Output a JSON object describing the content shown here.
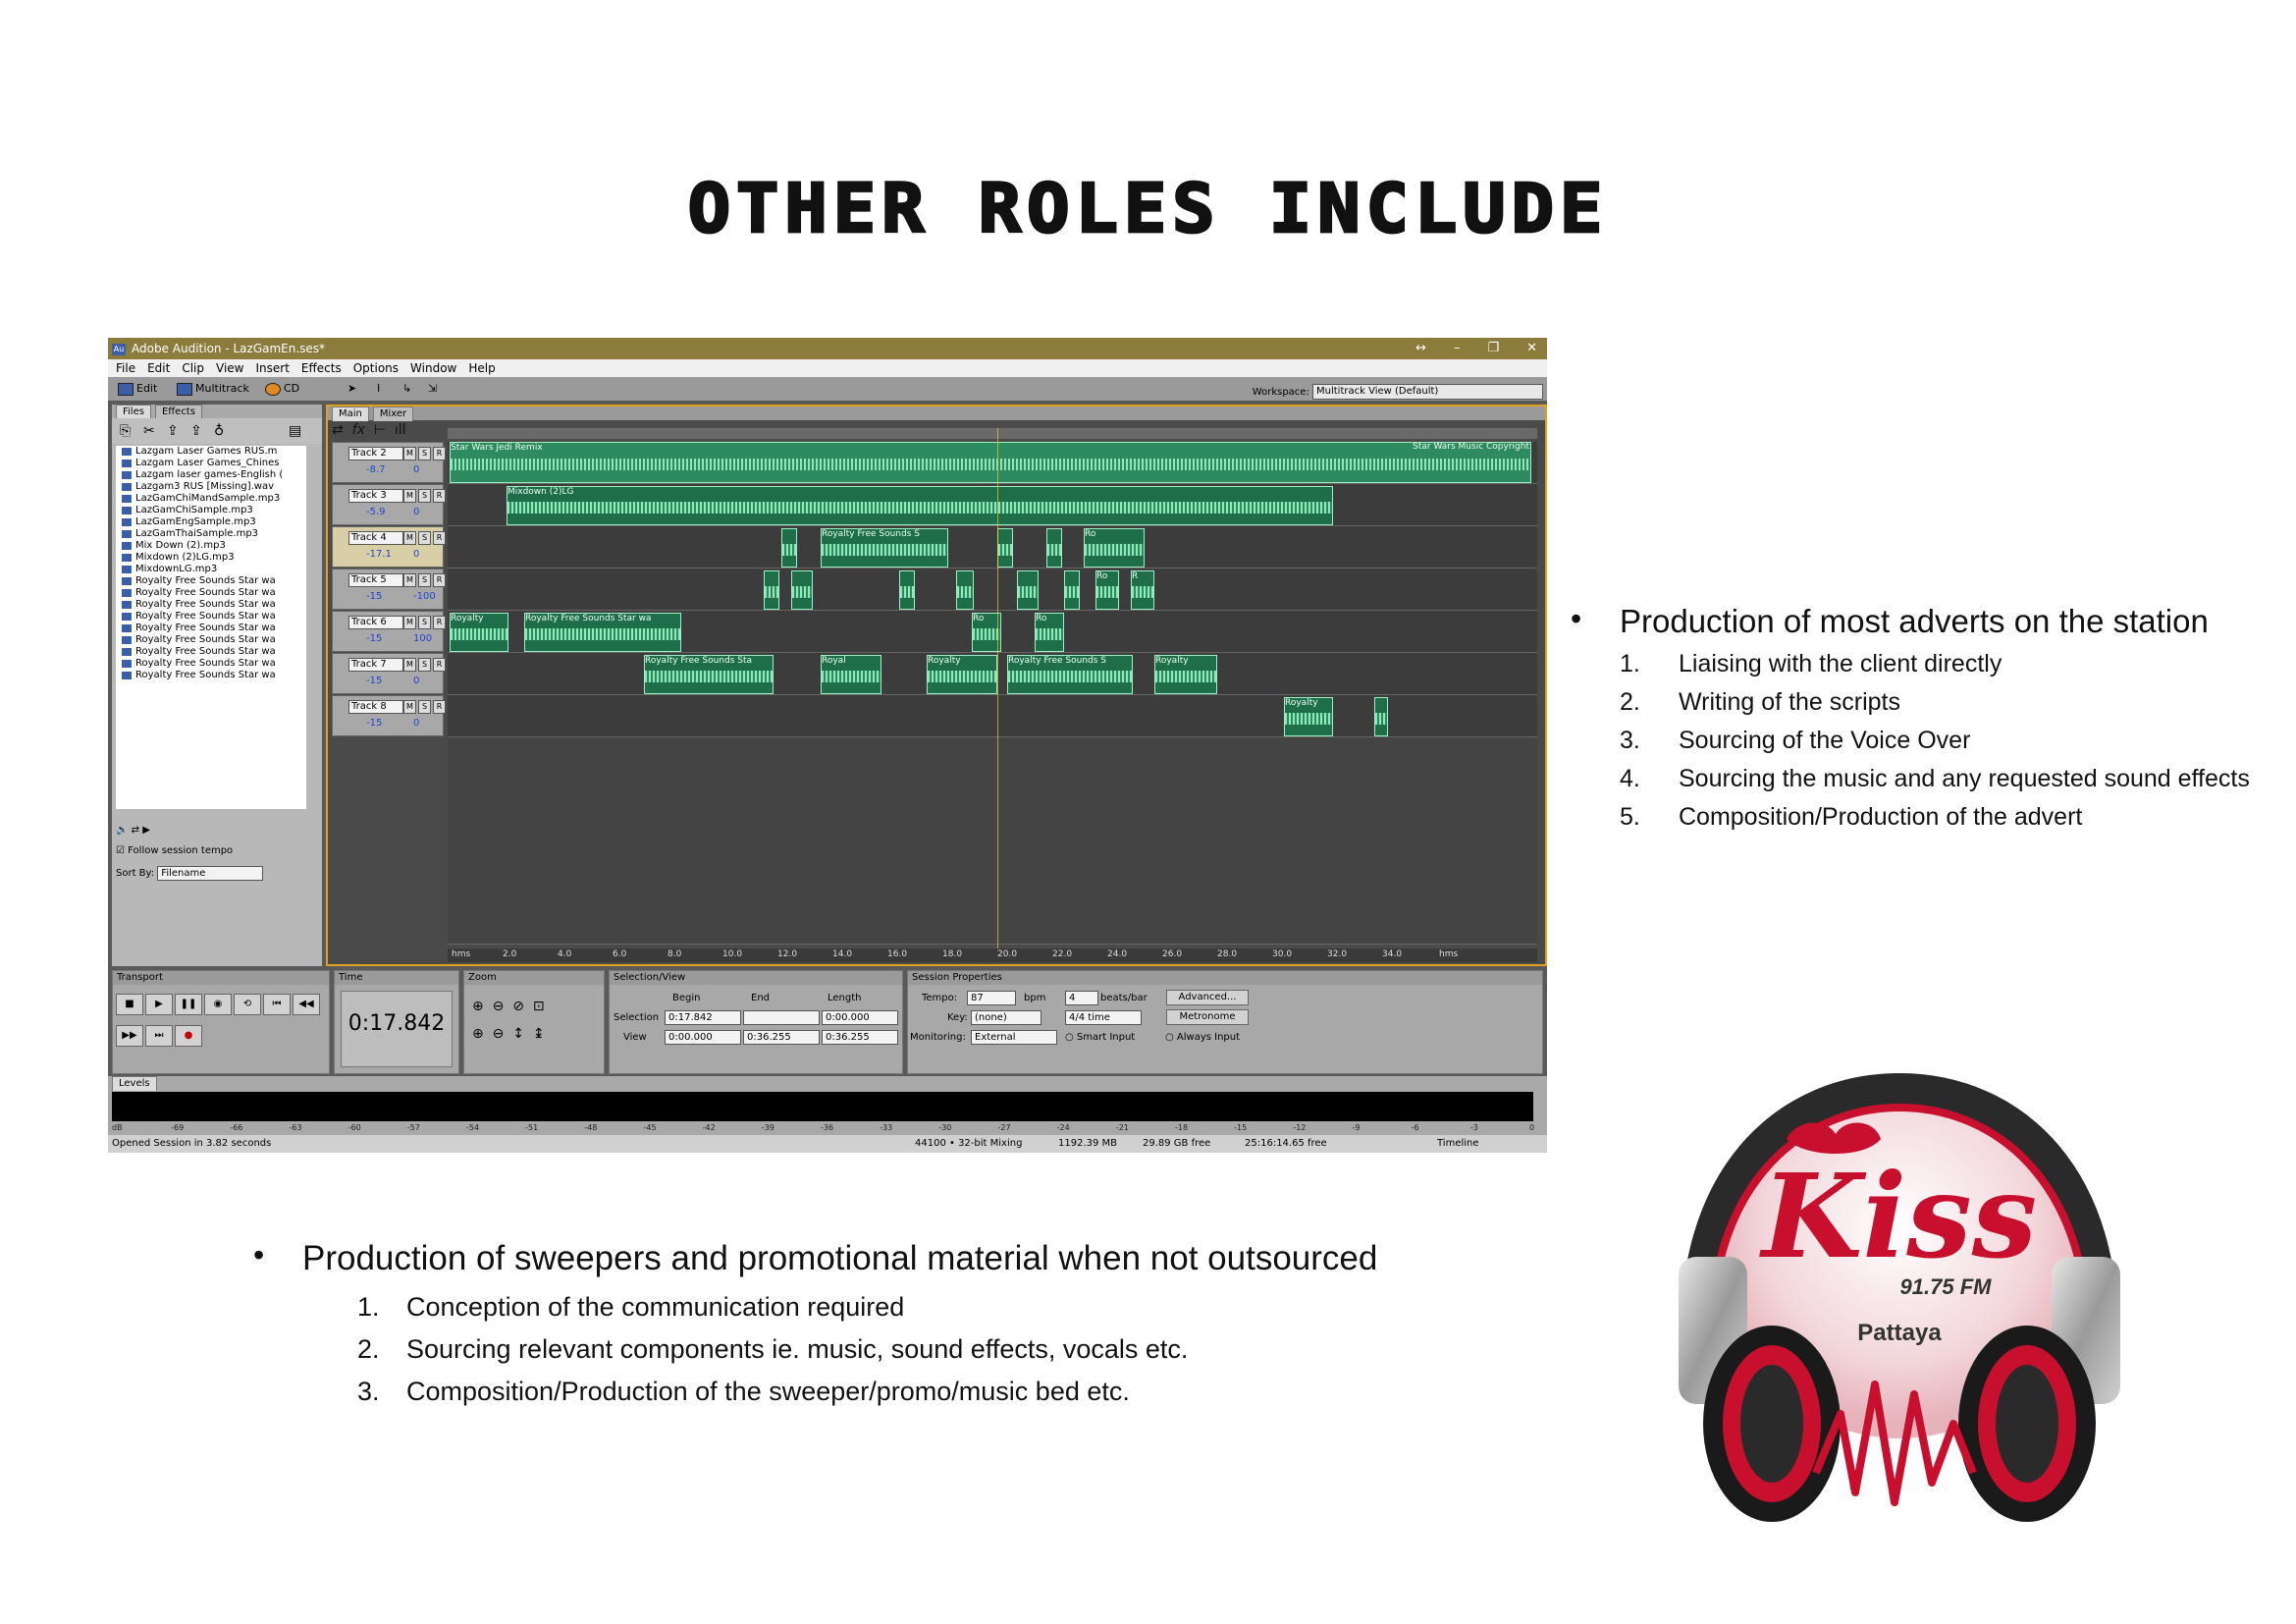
{
  "page_title": "OTHER ROLES INCLUDE",
  "app": {
    "title": "Adobe Audition - LazGamEn.ses*",
    "icon_label": "Au",
    "window_buttons": [
      "↔",
      "–",
      "❐",
      "✕"
    ],
    "menu": [
      "File",
      "Edit",
      "Clip",
      "View",
      "Insert",
      "Effects",
      "Options",
      "Window",
      "Help"
    ],
    "toolbar": {
      "edit": "Edit",
      "multitrack": "Multitrack",
      "cd": "CD",
      "workspace_label": "Workspace:",
      "workspace_value": "Multitrack View (Default)"
    },
    "files_panel": {
      "tabs": [
        "Files",
        "Effects"
      ],
      "items": [
        "Lazgam Laser Games RUS.m",
        "Lazgam Laser Games_Chines",
        "Lazgam laser games-English (",
        "Lazgam3 RUS [Missing].wav",
        "LazGamChiMandSample.mp3",
        "LazGamChiSample.mp3",
        "LazGamEngSample.mp3",
        "LazGamThaiSample.mp3",
        "Mix Down (2).mp3",
        "Mixdown (2)LG.mp3",
        "MixdownLG.mp3",
        "Royalty Free Sounds Star wa",
        "Royalty Free Sounds Star wa",
        "Royalty Free Sounds Star wa",
        "Royalty Free Sounds Star wa",
        "Royalty Free Sounds Star wa",
        "Royalty Free Sounds Star wa",
        "Royalty Free Sounds Star wa",
        "Royalty Free Sounds Star wa",
        "Royalty Free Sounds Star wa"
      ],
      "follow_tempo": "Follow session tempo",
      "sort_label": "Sort By:",
      "sort_value": "Filename"
    },
    "main_tabs": [
      "Main",
      "Mixer"
    ],
    "tracks": [
      {
        "name": "Track 2",
        "vol": "-8.7",
        "pan": "0",
        "clips": [
          "Star Wars Jedi Remix",
          "Star Wars Music Copyright"
        ]
      },
      {
        "name": "Track 3",
        "vol": "-5.9",
        "pan": "0",
        "clips": [
          "Mixdown (2)LG"
        ]
      },
      {
        "name": "Track 4",
        "vol": "-17.1",
        "pan": "0",
        "clips": [
          "Royalty Free Sounds S",
          "Ro"
        ]
      },
      {
        "name": "Track 5",
        "vol": "-15",
        "pan": "-100",
        "clips": [
          "Ro",
          "R"
        ]
      },
      {
        "name": "Track 6",
        "vol": "-15",
        "pan": "100",
        "clips": [
          "Royalty",
          "Royalty Free Sounds Star wa",
          "Ro",
          "Ro"
        ]
      },
      {
        "name": "Track 7",
        "vol": "-15",
        "pan": "0",
        "clips": [
          "Royalty Free Sounds Sta",
          "Royal",
          "Royalty",
          "Royalty Free Sounds S",
          "Royalty"
        ]
      },
      {
        "name": "Track 8",
        "vol": "-15",
        "pan": "0",
        "clips": [
          "Royalty"
        ]
      }
    ],
    "ruler": [
      "hms",
      "2.0",
      "4.0",
      "6.0",
      "8.0",
      "10.0",
      "12.0",
      "14.0",
      "16.0",
      "18.0",
      "20.0",
      "22.0",
      "24.0",
      "26.0",
      "28.0",
      "30.0",
      "32.0",
      "34.0",
      "hms"
    ],
    "transport_title": "Transport",
    "time_title": "Time",
    "time_value": "0:17.842",
    "zoom_title": "Zoom",
    "selection": {
      "title": "Selection/View",
      "begin": "Begin",
      "end": "End",
      "length": "Length",
      "sel_label": "Selection",
      "view_label": "View",
      "sel_begin": "0:17.842",
      "sel_end": "",
      "sel_length": "0:00.000",
      "view_begin": "0:00.000",
      "view_end": "0:36.255",
      "view_length": "0:36.255"
    },
    "session": {
      "title": "Session Properties",
      "tempo_label": "Tempo:",
      "tempo": "87",
      "bpm": "bpm",
      "beats": "4",
      "beats_label": "beats/bar",
      "advanced": "Advanced...",
      "key_label": "Key:",
      "key": "(none)",
      "time_sig": "4/4 time",
      "metronome": "Metronome",
      "monitoring_label": "Monitoring:",
      "monitoring": "External",
      "smart": "Smart Input",
      "always": "Always Input"
    },
    "levels_title": "Levels",
    "level_scale": [
      "dB",
      "-69",
      "-66",
      "-63",
      "-60",
      "-57",
      "-54",
      "-51",
      "-48",
      "-45",
      "-42",
      "-39",
      "-36",
      "-33",
      "-30",
      "-27",
      "-24",
      "-21",
      "-18",
      "-15",
      "-12",
      "-9",
      "-6",
      "-3",
      "0"
    ],
    "status": [
      "Opened Session in 3.82 seconds",
      "44100 • 32-bit Mixing",
      "1192.39 MB",
      "29.89 GB free",
      "25:16:14.65 free",
      "Timeline"
    ]
  },
  "right_list": {
    "heading": "Production of most adverts on the station",
    "items": [
      {
        "n": "1.",
        "text": "Liaising with the client directly"
      },
      {
        "n": "2.",
        "text": "Writing of the scripts"
      },
      {
        "n": "3.",
        "text": "Sourcing of the Voice Over"
      },
      {
        "n": "4.",
        "text": "Sourcing the music and any requested sound effects"
      },
      {
        "n": "5.",
        "text": "Composition/Production of the advert"
      }
    ]
  },
  "bottom_list": {
    "heading": "Production of sweepers and promotional material when not outsourced",
    "items": [
      {
        "n": "1.",
        "text": "Conception of the communication required"
      },
      {
        "n": "2.",
        "text": "Sourcing relevant components ie. music, sound effects, vocals etc."
      },
      {
        "n": "3.",
        "text": "Composition/Production of the sweeper/promo/music bed etc."
      }
    ]
  },
  "logo": {
    "brand": "Kiss",
    "frequency": "91.75 FM",
    "city": "Pattaya"
  },
  "colors": {
    "clip_green": "#1f6e4a",
    "accent_orange": "#e0a020",
    "logo_red": "#c8102e"
  }
}
